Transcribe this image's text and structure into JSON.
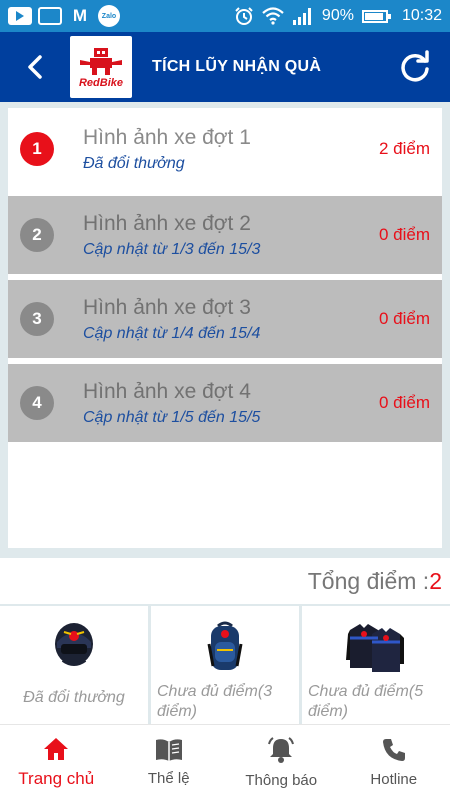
{
  "status_bar": {
    "zalo_label": "Zalo",
    "battery": "90%",
    "time": "10:32"
  },
  "app_bar": {
    "logo_text": "RedBike",
    "title": "TÍCH LŨY NHẬN QUÀ"
  },
  "rounds": [
    {
      "number": "1",
      "title": "Hình ảnh xe đợt 1",
      "subtitle": "Đã đổi thưởng",
      "points": "2 điểm",
      "active": true
    },
    {
      "number": "2",
      "title": "Hình ảnh xe đợt 2",
      "subtitle": "Cập nhật từ 1/3 đến 15/3",
      "points": "0 điểm",
      "active": false
    },
    {
      "number": "3",
      "title": "Hình ảnh xe đợt 3",
      "subtitle": "Cập nhật từ 1/4 đến 15/4",
      "points": "0 điểm",
      "active": false
    },
    {
      "number": "4",
      "title": "Hình ảnh xe đợt 4",
      "subtitle": "Cập nhật từ 1/5 đến 15/5",
      "points": "0 điểm",
      "active": false
    }
  ],
  "total": {
    "label": "Tổng điểm :",
    "value": "2"
  },
  "rewards": [
    {
      "icon": "helmet",
      "label": "Đã đổi thưởng"
    },
    {
      "icon": "backpack",
      "label": "Chưa đủ điểm(3 điểm)"
    },
    {
      "icon": "jacket",
      "label": "Chưa đủ điểm(5 điểm)"
    }
  ],
  "bottom_nav": [
    {
      "icon": "home-icon",
      "label": "Trang chủ",
      "active": true
    },
    {
      "icon": "book-icon",
      "label": "Thể lệ",
      "active": false
    },
    {
      "icon": "bell-icon",
      "label": "Thông báo",
      "active": false
    },
    {
      "icon": "phone-icon",
      "label": "Hotline",
      "active": false
    }
  ],
  "colors": {
    "app_bar": "#003f9e",
    "status_bar": "#1c87c9",
    "accent_red": "#e8101a",
    "disabled_row": "#bcbcbc"
  }
}
